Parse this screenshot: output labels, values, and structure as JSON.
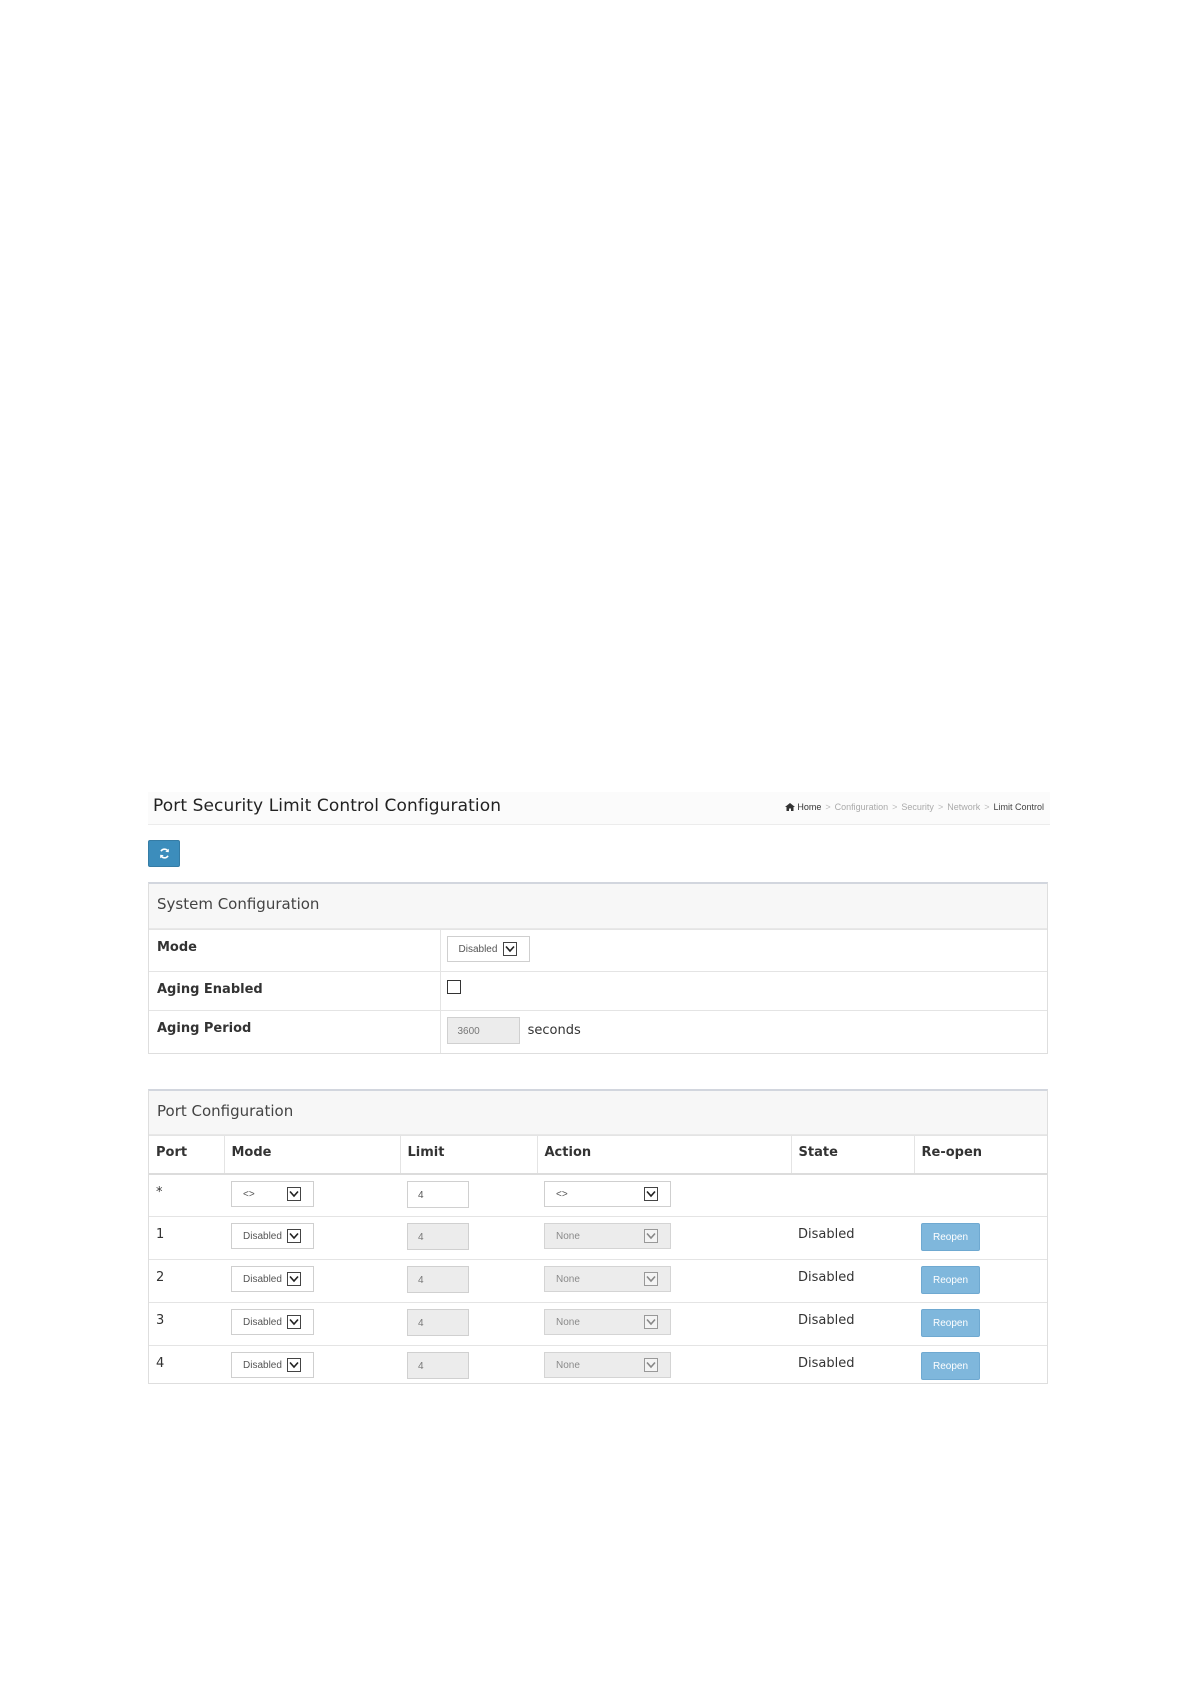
{
  "header": {
    "title": "Port Security Limit Control Configuration",
    "breadcrumb": [
      "Home",
      "Configuration",
      "Security",
      "Network",
      "Limit Control"
    ]
  },
  "toolbar": {
    "refresh_icon": "refresh-icon"
  },
  "system": {
    "title": "System Configuration",
    "mode_label": "Mode",
    "mode_value": "Disabled",
    "aging_enabled_label": "Aging Enabled",
    "aging_enabled_checked": false,
    "aging_period_label": "Aging Period",
    "aging_period_value": "3600",
    "aging_period_unit": "seconds"
  },
  "ports": {
    "title": "Port Configuration",
    "columns": [
      "Port",
      "Mode",
      "Limit",
      "Action",
      "State",
      "Re-open"
    ],
    "rows": [
      {
        "port": "*",
        "mode": "<>",
        "limit": "4",
        "action": "<>",
        "state": "",
        "reopen": ""
      },
      {
        "port": "1",
        "mode": "Disabled",
        "limit": "4",
        "action": "None",
        "state": "Disabled",
        "reopen": "Reopen"
      },
      {
        "port": "2",
        "mode": "Disabled",
        "limit": "4",
        "action": "None",
        "state": "Disabled",
        "reopen": "Reopen"
      },
      {
        "port": "3",
        "mode": "Disabled",
        "limit": "4",
        "action": "None",
        "state": "Disabled",
        "reopen": "Reopen"
      },
      {
        "port": "4",
        "mode": "Disabled",
        "limit": "4",
        "action": "None",
        "state": "Disabled",
        "reopen": "Reopen"
      }
    ]
  },
  "colors": {
    "primary": "#3c8dbc",
    "reopen": "#7fb7dc"
  }
}
